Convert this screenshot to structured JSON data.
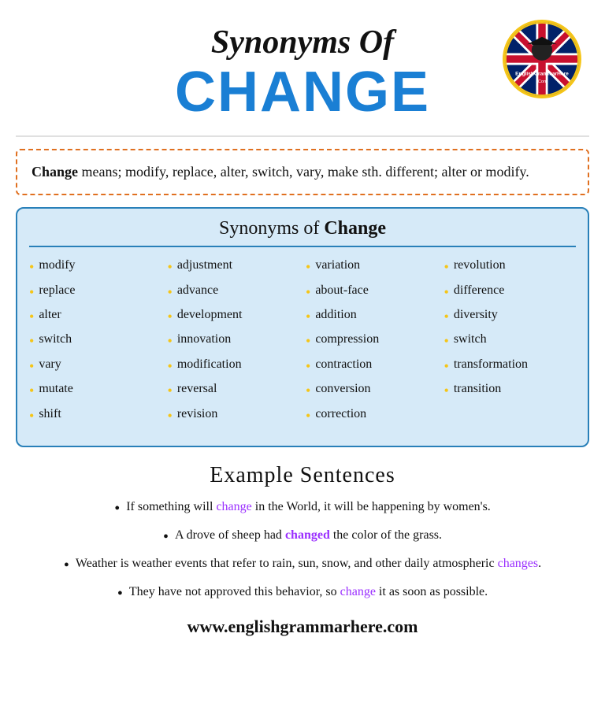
{
  "header": {
    "synonyms_of": "Synonyms Of",
    "change": "CHANGE"
  },
  "definition": {
    "bold": "Change",
    "rest": " means; modify, replace, alter, switch, vary, make sth. different; alter or modify."
  },
  "synonyms_section": {
    "title_plain": "Synonyms of ",
    "title_bold": "Change",
    "columns": [
      [
        "modify",
        "replace",
        "alter",
        "switch",
        "vary",
        "mutate",
        "shift"
      ],
      [
        "adjustment",
        "advance",
        "development",
        "innovation",
        "modification",
        "reversal",
        "revision"
      ],
      [
        "variation",
        "about-face",
        "addition",
        "compression",
        "contraction",
        "conversion",
        "correction"
      ],
      [
        "revolution",
        "difference",
        "diversity",
        "switch",
        "transformation",
        "transition"
      ]
    ]
  },
  "examples_section": {
    "title": "Example  Sentences",
    "sentences": [
      {
        "parts": [
          {
            "text": "If something will ",
            "style": "normal"
          },
          {
            "text": "change",
            "style": "purple"
          },
          {
            "text": " in the World, it will be happening by women's.",
            "style": "normal"
          }
        ]
      },
      {
        "parts": [
          {
            "text": "A drove of sheep had ",
            "style": "normal"
          },
          {
            "text": "changed",
            "style": "purple-bold"
          },
          {
            "text": " the color of the grass.",
            "style": "normal"
          }
        ]
      },
      {
        "parts": [
          {
            "text": "Weather is weather events that refer to rain, sun, snow, and other daily atmospheric ",
            "style": "normal"
          },
          {
            "text": "changes",
            "style": "purple"
          },
          {
            "text": ".",
            "style": "normal"
          }
        ]
      },
      {
        "parts": [
          {
            "text": "They have not approved this behavior, so ",
            "style": "normal"
          },
          {
            "text": "change",
            "style": "purple"
          },
          {
            "text": " it as soon as possible.",
            "style": "normal"
          }
        ]
      }
    ]
  },
  "footer": {
    "website": "www.englishgrammarhere.com"
  }
}
